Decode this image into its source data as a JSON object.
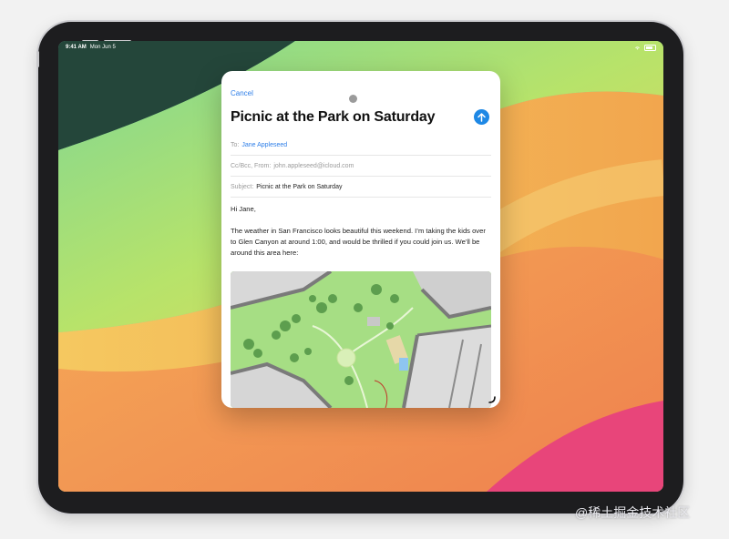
{
  "status_bar": {
    "time": "9:41 AM",
    "date": "Mon Jun 5"
  },
  "compose": {
    "cancel_label": "Cancel",
    "title": "Picnic at the Park on Saturday",
    "to_label": "To:",
    "to_value": "Jane Appleseed",
    "cc_label": "Cc/Bcc, From:",
    "cc_value": "john.appleseed@icloud.com",
    "subject_label": "Subject:",
    "subject_value": "Picnic at the Park on Saturday",
    "greeting": "Hi Jane,",
    "body": "The weather in San Francisco looks beautiful this weekend. I’m taking the kids over to Glen Canyon at around 1:00, and would be thrilled if you could join us. We’ll be around this area here:"
  },
  "icons": {
    "send": "arrow-up-icon",
    "resize": "resize-corner-icon"
  },
  "watermark": "@稀土掘金技术社区",
  "colors": {
    "accent": "#2d7ee8",
    "send_button": "#1e88e5"
  }
}
